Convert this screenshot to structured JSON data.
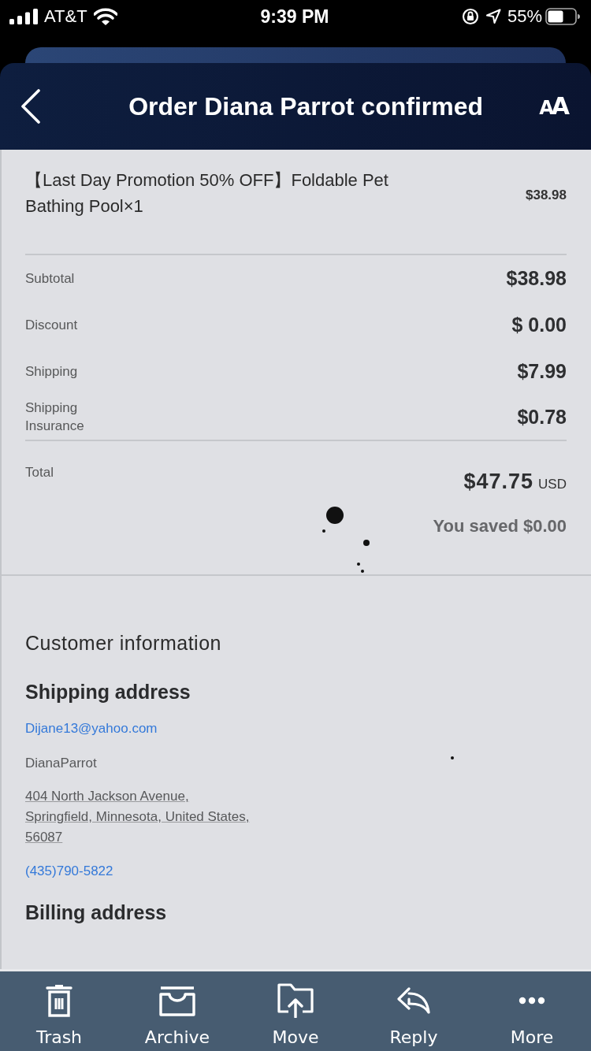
{
  "status_bar": {
    "carrier": "AT&T",
    "time": "9:39 PM",
    "battery": "55%"
  },
  "header": {
    "title": "Order Diana Parrot confirmed",
    "text_size_button": "AA"
  },
  "order": {
    "items": [
      {
        "name": "【Last Day Promotion 50% OFF】Foldable Pet Bathing Pool×1",
        "price": "$38.98"
      }
    ],
    "summary": [
      {
        "label": "Subtotal",
        "value": "$38.98"
      },
      {
        "label": "Discount",
        "value": "$ 0.00"
      },
      {
        "label": "Shipping",
        "value": "$7.99"
      },
      {
        "label": "Shipping\nInsurance",
        "value": "$0.78"
      }
    ],
    "total": {
      "label": "Total",
      "amount": "$47.75",
      "currency": "USD",
      "savings": "You saved $0.00"
    }
  },
  "customer": {
    "heading": "Customer information",
    "shipping": {
      "heading": "Shipping address",
      "email": "Dijane13@yahoo.com",
      "name": "DianaParrot",
      "address": "404 North Jackson Avenue,\nSpringfield, Minnesota, United States,\n56087",
      "phone": "(435)790-5822"
    },
    "billing": {
      "heading": "Billing address"
    }
  },
  "toolbar": [
    {
      "label": "Trash",
      "kind": "trash"
    },
    {
      "label": "Archive",
      "kind": "archive"
    },
    {
      "label": "Move",
      "kind": "move"
    },
    {
      "label": "Reply",
      "kind": "reply"
    },
    {
      "label": "More",
      "kind": "more"
    }
  ]
}
